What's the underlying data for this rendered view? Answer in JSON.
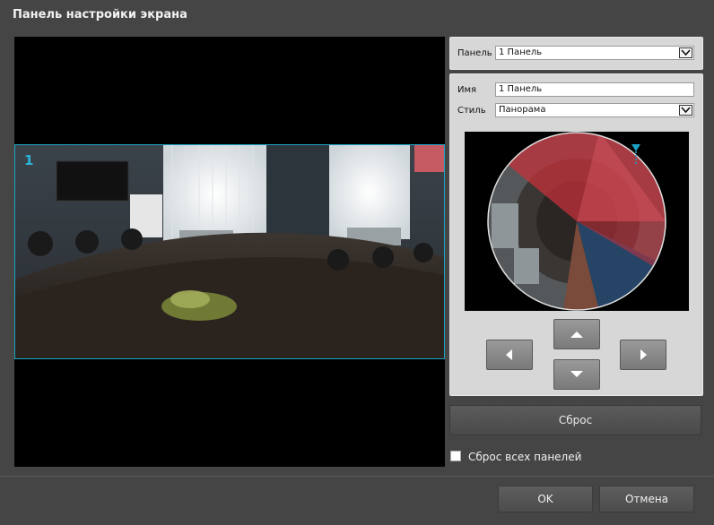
{
  "dialog": {
    "title": "Панель настройки экрана"
  },
  "preview": {
    "panel_number": "1"
  },
  "panel_selector": {
    "label": "Панель",
    "selected": "1 Панель"
  },
  "settings": {
    "name_label": "Имя",
    "name_value": "1 Панель",
    "style_label": "Стиль",
    "style_selected": "Панорама"
  },
  "reset": {
    "button_label": "Сброс",
    "all_panels_label": "Сброс всех панелей",
    "all_panels_checked": false
  },
  "footer": {
    "ok_label": "OK",
    "cancel_label": "Отмена"
  },
  "colors": {
    "accent": "#1aa3c4",
    "fisheye_overlay": "#c8303a"
  },
  "icons": {
    "nav_left": "arrow-left-icon",
    "nav_up": "arrow-up-icon",
    "nav_down": "arrow-down-icon",
    "nav_right": "arrow-right-icon"
  }
}
